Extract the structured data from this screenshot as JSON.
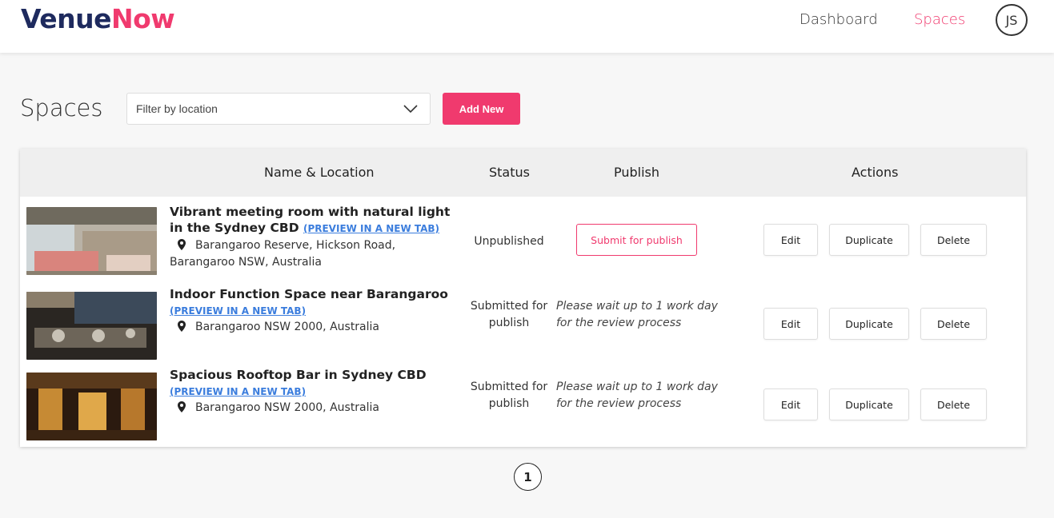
{
  "brand": {
    "part1": "Venue",
    "part2": "Now",
    "color1": "#1e2a5e",
    "color2": "#f03a6e"
  },
  "nav": {
    "dashboard": "Dashboard",
    "spaces": "Spaces",
    "avatar_initials": "JS"
  },
  "page": {
    "title": "Spaces"
  },
  "filter": {
    "placeholder": "Filter by location",
    "icon": "chevron-down-icon"
  },
  "add_button": "Add New",
  "table": {
    "headers": {
      "name_location": "Name & Location",
      "status": "Status",
      "publish": "Publish",
      "actions": "Actions"
    },
    "rows": [
      {
        "name": "Vibrant meeting room with natural light in the Sydney CBD",
        "preview": "(PREVIEW IN A NEW TAB)",
        "location": "Barangaroo Reserve, Hickson Road, Barangaroo NSW, Australia",
        "status": "Unpublished",
        "publish_button": "Submit for publish",
        "actions": {
          "edit": "Edit",
          "duplicate": "Duplicate",
          "delete": "Delete"
        }
      },
      {
        "name": "Indoor Function Space near Barangaroo",
        "preview": "(PREVIEW IN A NEW TAB)",
        "location": "Barangaroo NSW 2000, Australia",
        "status": "Submitted for publish",
        "publish_note": "Please wait up to 1 work day for the review process",
        "actions": {
          "edit": "Edit",
          "duplicate": "Duplicate",
          "delete": "Delete"
        }
      },
      {
        "name": "Spacious Rooftop Bar in Sydney CBD",
        "preview": "(PREVIEW IN A NEW TAB)",
        "location": "Barangaroo NSW 2000, Australia",
        "status": "Submitted for publish",
        "publish_note": "Please wait up to 1 work day for the review process",
        "actions": {
          "edit": "Edit",
          "duplicate": "Duplicate",
          "delete": "Delete"
        }
      }
    ]
  },
  "pagination": {
    "current": "1"
  }
}
